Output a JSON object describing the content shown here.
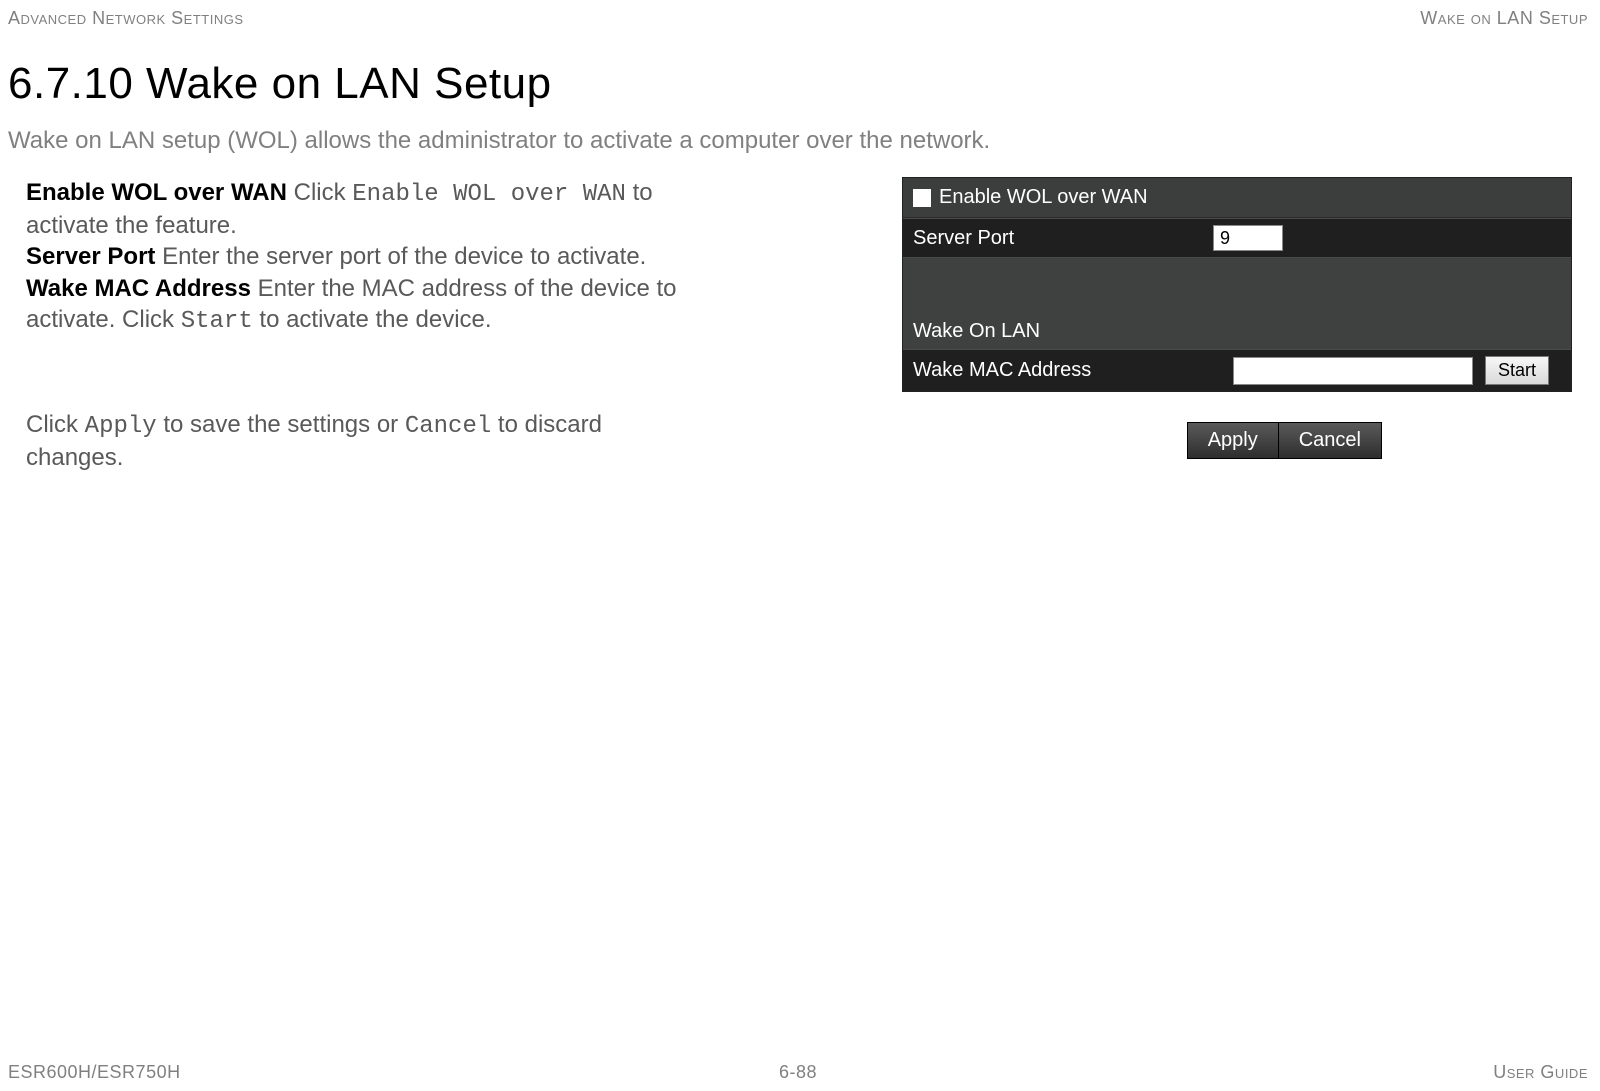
{
  "header": {
    "left": "Advanced Network Settings",
    "right": "Wake on LAN Setup"
  },
  "title": "6.7.10 Wake on LAN Setup",
  "intro": "Wake on LAN setup (WOL) allows the administrator to activate a computer over the network.",
  "descriptions": {
    "enable_term": "Enable WOL over WAN",
    "enable_pre": "  Click ",
    "enable_code": "Enable WOL over WAN",
    "enable_post": " to activate the feature.",
    "server_term": "Server Port",
    "server_text": "  Enter the server port of the device to activate.",
    "mac_term": "Wake MAC Address",
    "mac_pre": "  Enter the MAC address of the device to activate. Click ",
    "mac_code": "Start",
    "mac_post": " to activate the device."
  },
  "apply_block": {
    "pre": "Click ",
    "code1": "Apply",
    "mid": " to save the settings or ",
    "code2": "Cancel",
    "post": " to discard changes."
  },
  "router_ui": {
    "enable_label": "Enable WOL over WAN",
    "server_port_label": "Server Port",
    "server_port_value": "9",
    "section_label": "Wake On LAN",
    "mac_label": "Wake MAC Address",
    "mac_value": "",
    "start_btn": "Start",
    "apply_btn": "Apply",
    "cancel_btn": "Cancel"
  },
  "footer": {
    "left": "ESR600H/ESR750H",
    "center": "6-88",
    "right": "User Guide"
  }
}
